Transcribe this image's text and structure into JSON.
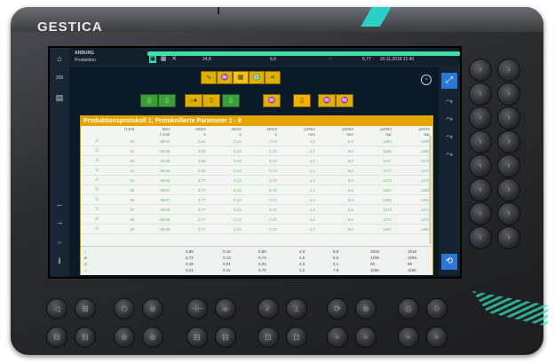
{
  "brand": "GESTICA",
  "topbar": {
    "logo_text": "ARBURG",
    "mode": "Produktion",
    "value1": "24,8",
    "value2": "6,0",
    "count": "5,77",
    "datetime": "20.11.2018  11:40"
  },
  "leftnav": {
    "home": "⌂",
    "item2": "205",
    "arrow_left": "←",
    "arrow_right": "→",
    "info": "i"
  },
  "toolbar_top": [
    "∿",
    "♒",
    "▦",
    "♎",
    "⋖"
  ],
  "toolbar_mid": {
    "green": [
      "▯",
      "▯"
    ],
    "yellow1": [
      "⌂●",
      "▯"
    ],
    "orange": [
      "▯"
    ],
    "yellow2": [
      "♒",
      "♒"
    ]
  },
  "panel": {
    "title": "Produktionsprotokoll 1, Protokollierte Parameter 1 - 8",
    "headers": [
      "",
      "f1403",
      "t001",
      "t4013",
      "t4018",
      "t4013",
      "p4062",
      "p4063",
      "p4053",
      "p4072"
    ],
    "units": [
      "",
      "",
      "h:mm",
      "s",
      "s",
      "s",
      "mm",
      "mm",
      "bar",
      "bar"
    ],
    "rows": [
      [
        "☑",
        "90",
        "09:54",
        "3,81",
        "0,13",
        "0,72",
        "4,2",
        "8,5",
        "1290",
        "1290"
      ],
      [
        "☑",
        "91",
        "09:55",
        "3,80",
        "0,13",
        "0,72",
        "4,2",
        "8,5",
        "1286",
        "1286"
      ],
      [
        "☑",
        "92",
        "09:55",
        "3,81",
        "0,13",
        "0,72",
        "4,2",
        "8,5",
        "1271",
        "1271"
      ],
      [
        "☑",
        "93",
        "09:56",
        "3,81",
        "0,13",
        "0,72",
        "4,2",
        "8,5",
        "1277",
        "1277"
      ],
      [
        "☑",
        "94",
        "09:56",
        "3,77",
        "0,13",
        "0,72",
        "4,2",
        "8,5",
        "1279",
        "1279"
      ],
      [
        "☑",
        "95",
        "09:57",
        "3,77",
        "0,13",
        "0,72",
        "4,2",
        "8,5",
        "1281",
        "1281"
      ],
      [
        "☑",
        "96",
        "09:57",
        "3,77",
        "0,13",
        "0,72",
        "4,2",
        "8,5",
        "1284",
        "1284"
      ],
      [
        "☑",
        "97",
        "09:58",
        "3,77",
        "0,13",
        "0,72",
        "4,2",
        "8,5",
        "1274",
        "1274"
      ],
      [
        "☑",
        "98",
        "09:58",
        "3,77",
        "0,13",
        "0,72",
        "4,2",
        "8,5",
        "1272",
        "1272"
      ],
      [
        "☑",
        "99",
        "09:59",
        "3,77",
        "0,13",
        "0,72",
        "4,2",
        "8,5",
        "1287",
        "1287"
      ]
    ],
    "summary": {
      "labels": [
        "↑",
        "ø",
        "σ",
        "↓"
      ],
      "col1": [
        "3,88",
        "3,72",
        "0,18",
        "3,41"
      ],
      "col2": [
        "0,16",
        "0,13",
        "0,01",
        "0,11"
      ],
      "col3": [
        "0,80",
        "0,74",
        "0,03",
        "0,72"
      ],
      "col4": [
        "4,9",
        "4,5",
        "2,6",
        "1,2"
      ],
      "col5": [
        "8,8",
        "8,6",
        "0,1",
        "7,9"
      ],
      "col6": [
        "1515",
        "1296",
        "69",
        "1156"
      ],
      "col7": [
        "1515",
        "1296",
        "69",
        "1156"
      ]
    }
  },
  "rightbar": [
    "⤢",
    "⤳",
    "⤳",
    "⤳",
    "⤳",
    "⟲"
  ],
  "hardware": {
    "right_labels": [
      "‹",
      "›"
    ],
    "bottom_row1": [
      "◁",
      "⊞",
      "⏻",
      "⊚",
      "⊣⊢",
      "⟚",
      "✓",
      "⟂",
      "⟳",
      "⊛",
      "◎",
      "⟐"
    ],
    "bottom_row2": [
      "⊟",
      "⊟",
      "⊚",
      "⊚",
      "⊟",
      "⊟",
      "⊡",
      "⊡",
      "≈",
      "≈",
      "≈",
      "≈"
    ]
  },
  "colors": {
    "accent_green": "#3ee0a8",
    "panel_header": "#e5a400",
    "data_green": "#5fbf5f"
  }
}
